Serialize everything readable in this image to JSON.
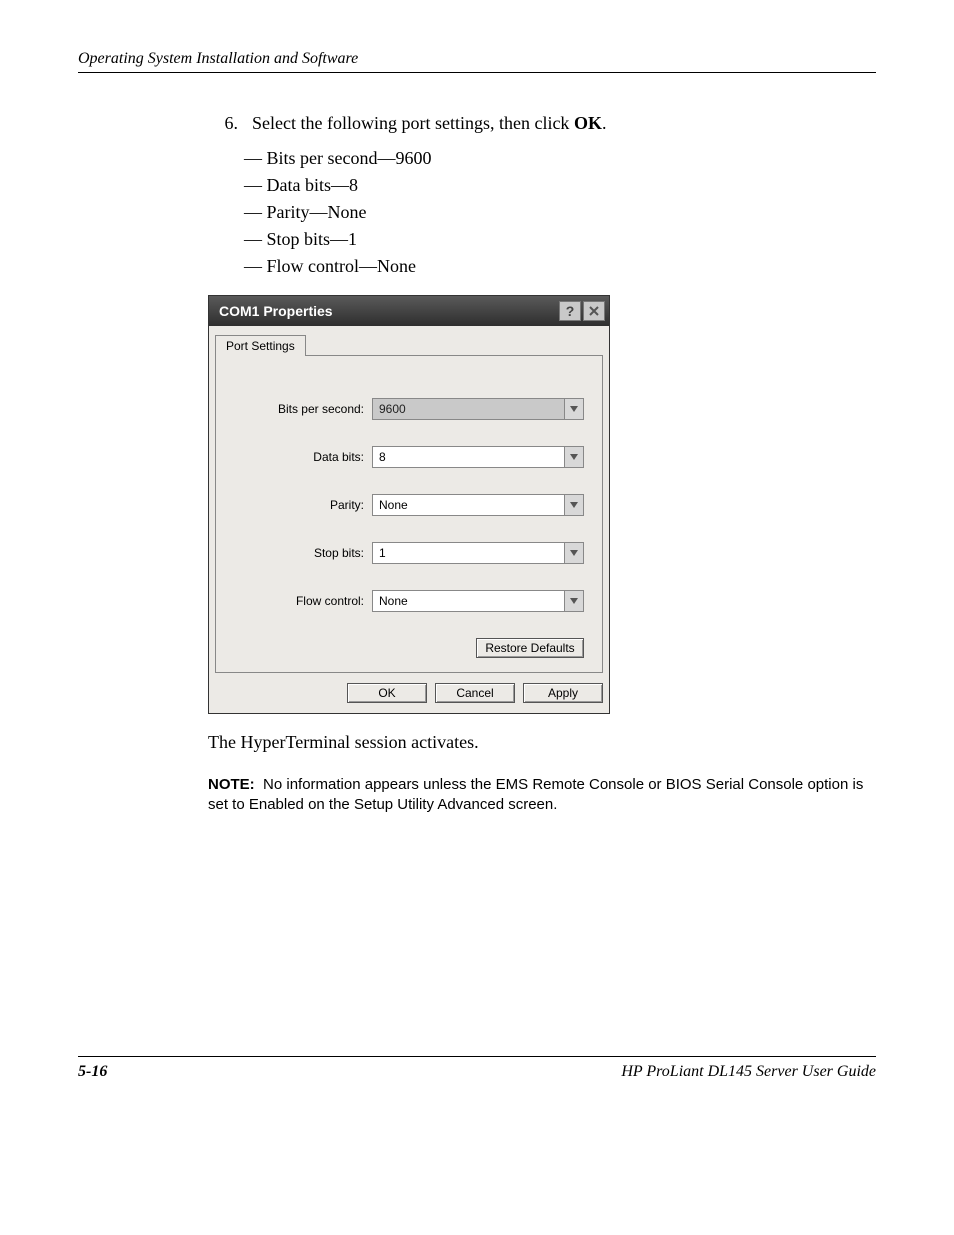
{
  "header": {
    "running_head": "Operating System Installation and Software"
  },
  "step": {
    "number": "6.",
    "text_before": "Select the following port settings, then click ",
    "text_bold": "OK",
    "text_after": "."
  },
  "bullets": [
    "Bits per second—9600",
    "Data bits—8",
    "Parity—None",
    "Stop bits—1",
    "Flow control—None"
  ],
  "dialog": {
    "title": "COM1 Properties",
    "tab": "Port Settings",
    "fields": {
      "bits_per_second": {
        "label": "Bits per second:",
        "value": "9600"
      },
      "data_bits": {
        "label": "Data bits:",
        "value": "8"
      },
      "parity": {
        "label": "Parity:",
        "value": "None"
      },
      "stop_bits": {
        "label": "Stop bits:",
        "value": "1"
      },
      "flow_control": {
        "label": "Flow control:",
        "value": "None"
      }
    },
    "buttons": {
      "restore": "Restore Defaults",
      "ok": "OK",
      "cancel": "Cancel",
      "apply": "Apply"
    }
  },
  "follow_text": "The HyperTerminal session activates.",
  "note": {
    "label": "NOTE:",
    "text": "No information appears unless the EMS Remote Console or BIOS Serial Console option is set to Enabled on the Setup Utility Advanced screen."
  },
  "footer": {
    "page": "5-16",
    "book": "HP ProLiant DL145 Server User Guide"
  }
}
